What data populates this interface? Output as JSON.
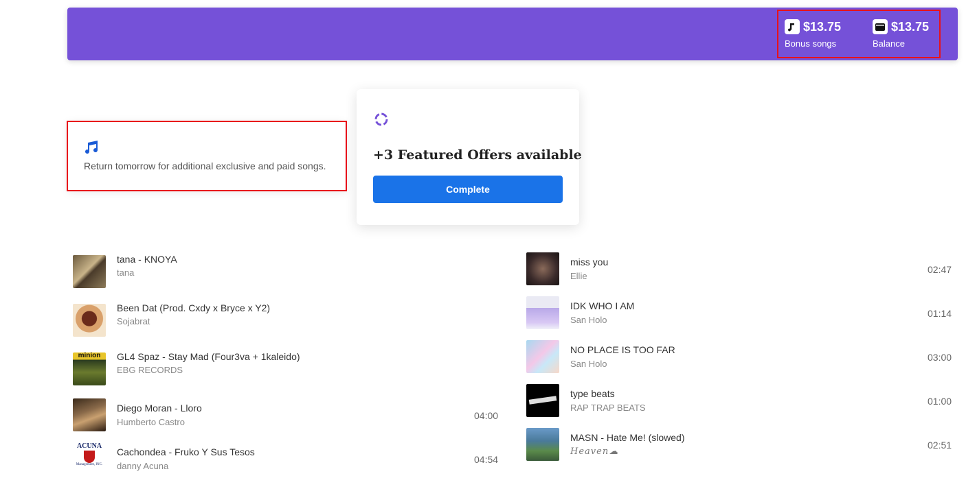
{
  "header": {
    "bonus": {
      "value": "$13.75",
      "label": "Bonus songs",
      "icon": "music-note-icon"
    },
    "balance": {
      "value": "$13.75",
      "label": "Balance",
      "icon": "wallet-icon"
    },
    "color": "#7551d8"
  },
  "notice": {
    "icon": "music-notes-icon",
    "text": "Return tomorrow for additional exclusive and paid songs."
  },
  "offer": {
    "title": "+3 Featured Offers available",
    "button": "Complete",
    "button_color": "#1a73e8"
  },
  "tracks_left": [
    {
      "title": "tana - KNOYA",
      "artist": "tana",
      "duration": ""
    },
    {
      "title": "Been Dat (Prod. Cxdy x Bryce x Y2)",
      "artist": "Sojabrat",
      "duration": ""
    },
    {
      "title": "GL4 Spaz - Stay Mad (Four3va + 1kaleido)",
      "artist": "EBG RECORDS",
      "duration": ""
    },
    {
      "title": "Diego Moran - Lloro",
      "artist": "Humberto Castro",
      "duration": "04:00"
    },
    {
      "title": "Cachondea - Fruko Y Sus Tesos",
      "artist": "danny Acuna",
      "duration": "04:54"
    }
  ],
  "tracks_right": [
    {
      "title": "miss you",
      "artist": "Ellie",
      "duration": "02:47"
    },
    {
      "title": "IDK WHO I AM",
      "artist": "San Holo",
      "duration": "01:14"
    },
    {
      "title": "NO PLACE IS TOO FAR",
      "artist": "San Holo",
      "duration": "03:00"
    },
    {
      "title": "type beats",
      "artist": "RAP TRAP BEATS",
      "duration": "01:00"
    },
    {
      "title": "MASN - Hate Me! (slowed)",
      "artist": "Heaven☁",
      "duration": "02:51"
    }
  ],
  "cover_logo_text": {
    "minion": "minion",
    "acuna": "ACUNA",
    "acuna_sub": "Management, INC."
  }
}
